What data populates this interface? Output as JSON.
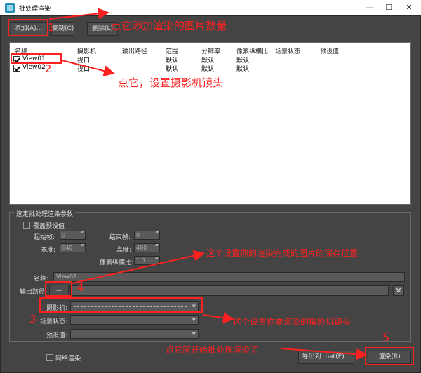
{
  "window": {
    "title": "批处理渲染",
    "minimize": "—",
    "maximize": "☐",
    "close": "✕"
  },
  "toolbar": {
    "add_label": "添加(A)...",
    "copy_label": "复制(C)",
    "delete_label": "删除(L)"
  },
  "list": {
    "columns": [
      "名称",
      "摄影机",
      "输出路径",
      "范围",
      "分辨率",
      "像素纵横比",
      "场景状态",
      "预设值"
    ],
    "rows": [
      {
        "checked": true,
        "name": "View01",
        "camera": "视口",
        "output": "",
        "range": "默认",
        "resolution": "默认",
        "aspect": "默认"
      },
      {
        "checked": true,
        "name": "View02",
        "camera": "视口",
        "output": "",
        "range": "默认",
        "resolution": "默认",
        "aspect": "默认"
      }
    ]
  },
  "params": {
    "group_title": "选定批处理渲染参数",
    "override_preset": "覆盖预设值",
    "start_frame_label": "起始帧:",
    "start_frame_value": "0",
    "end_frame_label": "结束帧:",
    "end_frame_value": "0",
    "width_label": "宽度:",
    "width_value": "640",
    "height_label": "高度:",
    "height_value": "480",
    "aspect_label": "像素纵横比:",
    "aspect_value": "1.0",
    "name_label": "名称:",
    "name_value": "View02",
    "output_path_label": "输出路径:",
    "browse_label": "...",
    "clear_label": "✕",
    "camera_label": "摄影机:",
    "scene_state_label": "场景状态:",
    "preset_label": "预设值:"
  },
  "bottom": {
    "net_render_label": "网络渲染",
    "export_label": "导出到 .bat(E)...",
    "render_label": "渲染(R)"
  },
  "annotations": {
    "n1": "1",
    "t1": "点它添加渲染的图片数量",
    "n2": "2",
    "t2": "点它，设置摄影机镜头",
    "t_path": "这个设置你的渲染完成的图片的保存位置",
    "n4": "4",
    "n3": "3",
    "t3": "这个设置你要渲染的摄影机镜头",
    "t4": "点它就开始批处理渲染了",
    "n5": "5"
  },
  "colors": {
    "annotation": "#ff2020",
    "dialog_bg": "#444444"
  }
}
